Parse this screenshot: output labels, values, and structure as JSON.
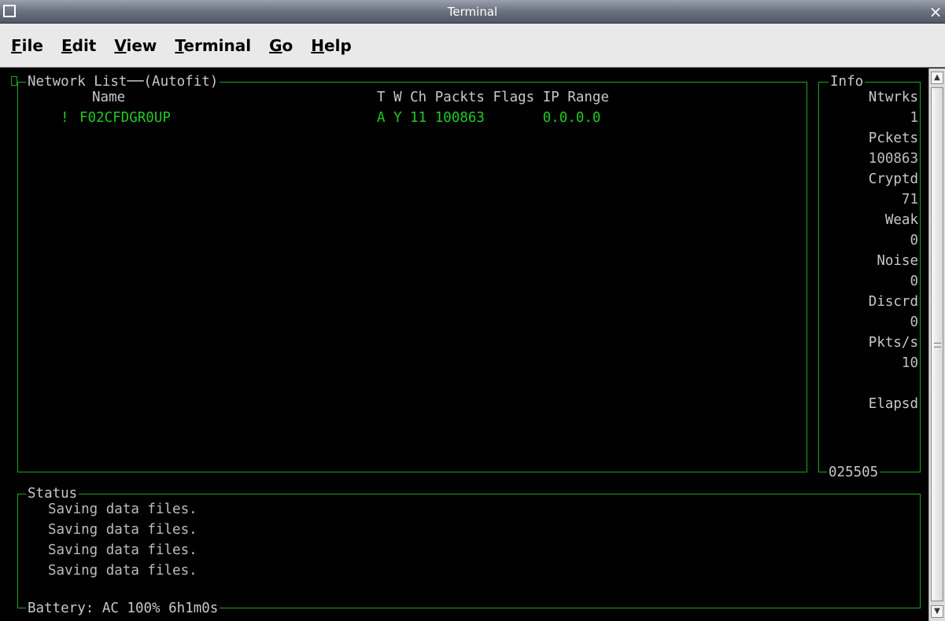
{
  "window": {
    "title": "Terminal",
    "close_glyph": "×"
  },
  "menu": [
    {
      "label_u": "F",
      "label_rest": "ile"
    },
    {
      "label_u": "E",
      "label_rest": "dit"
    },
    {
      "label_u": "V",
      "label_rest": "iew"
    },
    {
      "label_u": "T",
      "label_rest": "erminal"
    },
    {
      "label_u": "G",
      "label_rest": "o"
    },
    {
      "label_u": "H",
      "label_rest": "elp"
    }
  ],
  "network_list": {
    "title": "Network List──(Autofit)",
    "header_name": "Name",
    "header_cols": "T W Ch Packts Flags IP Range",
    "rows": [
      {
        "marker": "!",
        "name": "F02CFDGR0UP",
        "cols": "A Y 11 100863       0.0.0.0"
      }
    ]
  },
  "info": {
    "title": "Info",
    "lines": [
      "Ntwrks",
      "1",
      "Pckets",
      "100863",
      "Cryptd",
      "71",
      "Weak",
      "0",
      "Noise",
      "0",
      "Discrd",
      "0",
      "Pkts/s",
      "10",
      "",
      "Elapsd"
    ],
    "elapsed": "025505"
  },
  "status": {
    "title": "Status",
    "messages": [
      "Saving data files.",
      "Saving data files.",
      "Saving data files.",
      "Saving data files."
    ],
    "battery": "Battery: AC 100% 6h1m0s"
  },
  "colors": {
    "border": "#21a321",
    "highlight": "#22c922",
    "text": "#c8c8c8"
  }
}
